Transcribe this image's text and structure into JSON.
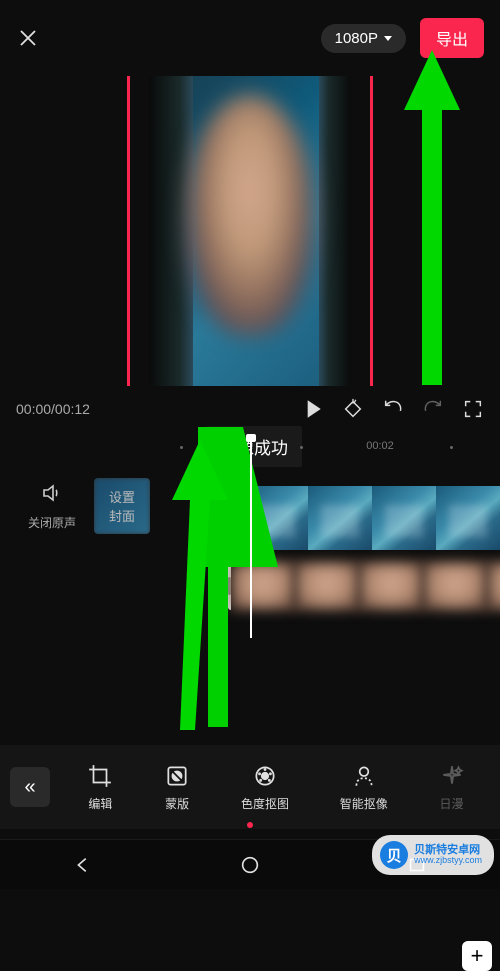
{
  "header": {
    "resolution_label": "1080P",
    "export_label": "导出"
  },
  "controls": {
    "time_display": "00:00/00:12"
  },
  "toast": {
    "message": "抠像成功"
  },
  "ruler": {
    "tick_label_1": "00:02"
  },
  "audio": {
    "mute_label": "关闭原声",
    "cover_label": "设置\n封面"
  },
  "add_clip_glyph": "+",
  "collapse_glyph": "«",
  "toolbar": {
    "items": [
      {
        "label": "编辑",
        "icon": "crop"
      },
      {
        "label": "蒙版",
        "icon": "mask"
      },
      {
        "label": "色度抠图",
        "icon": "chroma"
      },
      {
        "label": "智能抠像",
        "icon": "cutout"
      },
      {
        "label": "日漫",
        "icon": "anime"
      }
    ]
  },
  "watermark": {
    "line1": "贝斯特安卓网",
    "line2": "www.zjbstyy.com"
  }
}
